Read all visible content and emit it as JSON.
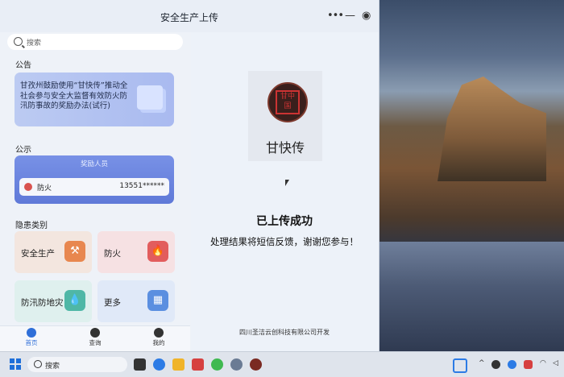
{
  "window": {
    "title": "安全生产上传",
    "more_glyph": "•••",
    "minimize_glyph": "—",
    "close_glyph": "◉"
  },
  "left": {
    "search_placeholder": "搜索",
    "notice_label": "公告",
    "notice_text": "甘孜州鼓励使用“甘快传”推动全社会参与安全大监督有效防火防汛防事故的奖励办法(试行)",
    "public_label": "公示",
    "award_header": "奖励人员",
    "award_row": {
      "name": "防火",
      "phone": "13551******"
    },
    "categories_label": "隐患类别",
    "categories": [
      {
        "label": "安全生产",
        "icon_glyph": "⚒",
        "bg": "#f3e6df",
        "icon_bg": "#e8874f"
      },
      {
        "label": "防火",
        "icon_glyph": "🔥",
        "bg": "#f6e1e3",
        "icon_bg": "#e25d5d"
      },
      {
        "label": "防汛防地灾",
        "icon_glyph": "💧",
        "bg": "#dff0ee",
        "icon_bg": "#4fb7a6"
      },
      {
        "label": "更多",
        "icon_glyph": "▦",
        "bg": "#e0e9f8",
        "icon_bg": "#5b8fe0"
      }
    ]
  },
  "bottomnav": [
    {
      "label": "首页",
      "active": true
    },
    {
      "label": "查询",
      "active": false
    },
    {
      "label": "我的",
      "active": false
    }
  ],
  "right": {
    "logo_seal": "甘中国",
    "logo_text": "甘快传",
    "success_title": "已上传成功",
    "success_sub": "处理结果将短信反馈，谢谢您参与！",
    "footer": "四川圣洁云创科技有限公司开发"
  },
  "taskbar": {
    "search_placeholder": "搜索"
  },
  "colors": {
    "accent": "#1e6fd9",
    "nav_active": "#2f6fd8"
  }
}
